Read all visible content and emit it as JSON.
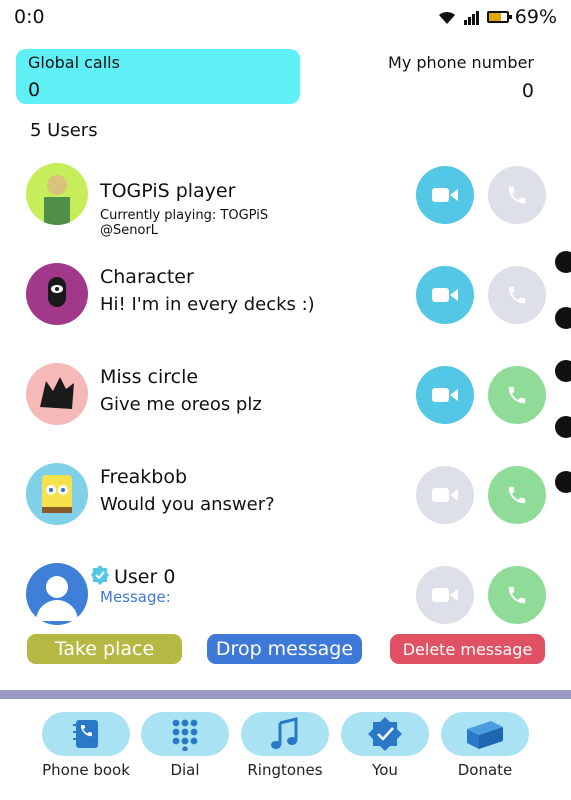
{
  "status_bar": {
    "time": "0:0",
    "battery": "69%",
    "battery_level": 0.69
  },
  "header": {
    "global_calls_label": "Global calls",
    "global_calls_value": "0",
    "my_phone_label": "My phone number",
    "my_phone_value": "0"
  },
  "users_count": "5 Users",
  "users": [
    {
      "name": "TOGPiS player",
      "message": "Currently playing: TOGPiS\n@SenorL",
      "video": "blue",
      "phone": "grey"
    },
    {
      "name": "Character",
      "message": "Hi! I'm in every decks :)",
      "video": "blue",
      "phone": "grey"
    },
    {
      "name": "Miss circle",
      "message": "Give me oreos plz",
      "video": "blue",
      "phone": "green"
    },
    {
      "name": "Freakbob",
      "message": "Would you answer?",
      "video": "grey",
      "phone": "green"
    },
    {
      "name": "User 0",
      "message": "Message:",
      "video": "grey",
      "phone": "green"
    }
  ],
  "actions": {
    "take_place": "Take place",
    "drop_message": "Drop message",
    "delete_message": "Delete message"
  },
  "nav": [
    {
      "label": "Phone book",
      "icon": "phone-book-icon"
    },
    {
      "label": "Dial",
      "icon": "dial-pad-icon"
    },
    {
      "label": "Ringtones",
      "icon": "music-note-icon"
    },
    {
      "label": "You",
      "icon": "verified-badge-icon"
    },
    {
      "label": "Donate",
      "icon": "donate-box-icon"
    }
  ],
  "colors": {
    "accent_cyan": "#5ef0f5",
    "call_blue": "#55c7e6",
    "call_green": "#8fdc98",
    "disabled_grey": "#dde0e8"
  }
}
